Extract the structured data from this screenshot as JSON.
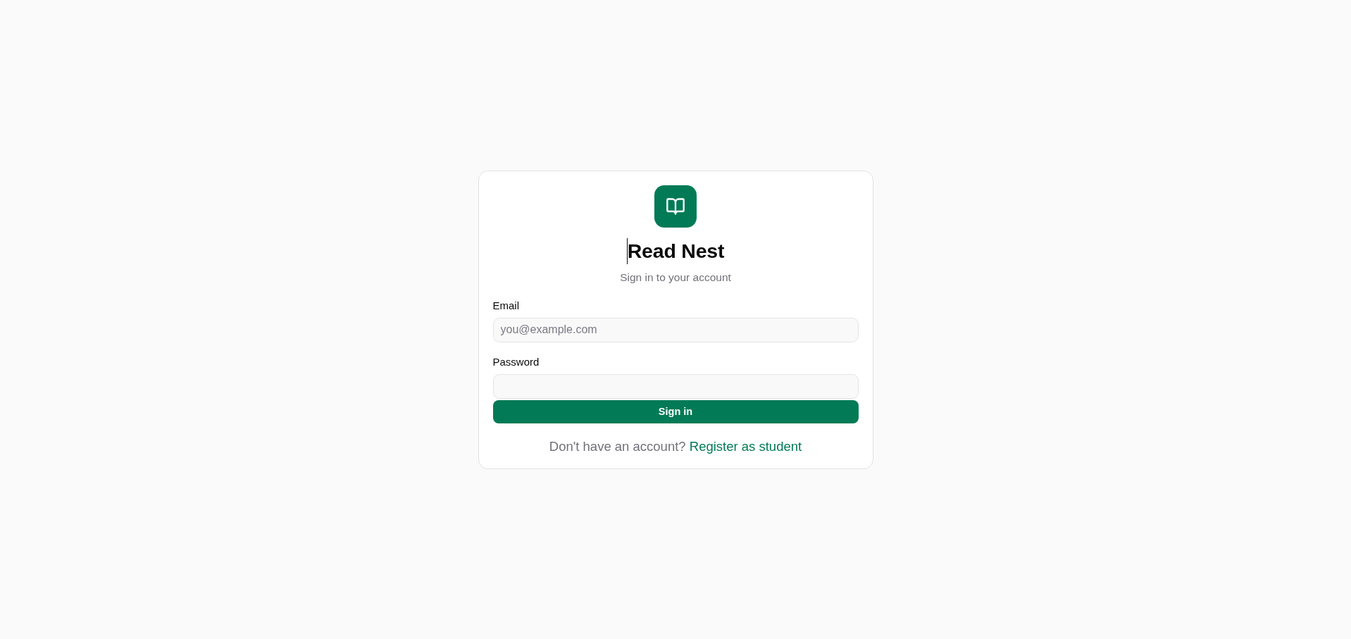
{
  "app": {
    "title": "Read Nest",
    "subtitle": "Sign in to your account"
  },
  "form": {
    "fields": [
      {
        "label": "Email",
        "placeholder": "you@example.com"
      },
      {
        "label": "Password"
      }
    ],
    "submit": "Sign in"
  },
  "footer": {
    "text": "Don't have an account?",
    "link": "Register as student"
  }
}
